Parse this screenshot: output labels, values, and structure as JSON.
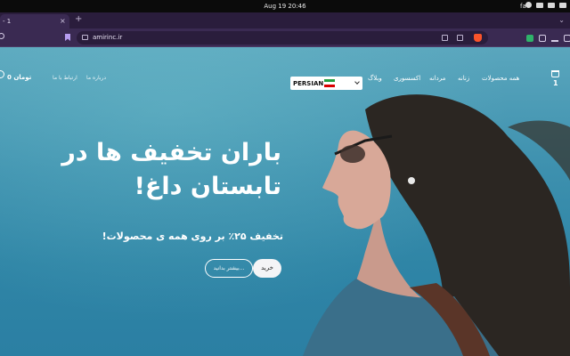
{
  "os": {
    "clock": "Aug 19  20:46",
    "lang": "fa"
  },
  "browser": {
    "tab_title": "- 1",
    "tab_close": "×",
    "new_tab": "+",
    "url": "amirinc.ir"
  },
  "site": {
    "cart_count": "1",
    "nav": [
      "همه محصولات",
      "زنانه",
      "مردانه",
      "اکسسوری",
      "وبلاگ"
    ],
    "language": "PERSIAN",
    "links": [
      "درباره ما",
      "ارتباط با ما"
    ],
    "balance": "0 تومان"
  },
  "hero": {
    "title_line1": "باران تخفیف ها در",
    "title_line2": "تابستان داغ!",
    "subtitle": "تخفیف ۲۵٪ بر روی همه ی محصولات!",
    "buy_label": "خرید",
    "more_label": "بیشتر بدانید..."
  },
  "colors": {
    "accent_purple": "#3a2a52",
    "brave": "#fb542b",
    "sky": "#3d90ae"
  }
}
